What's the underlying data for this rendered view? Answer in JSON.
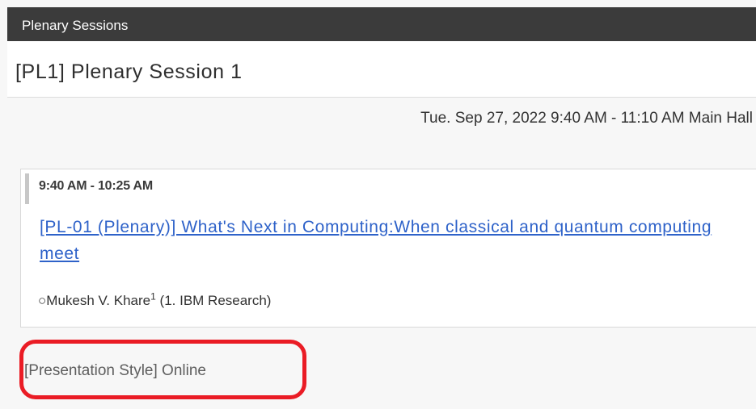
{
  "header": {
    "title": "Plenary Sessions"
  },
  "session": {
    "title": "[PL1] Plenary Session 1",
    "time_location": "Tue. Sep 27, 2022 9:40 AM - 11:10 AM Main Hall"
  },
  "presentation": {
    "time_range": "9:40 AM - 10:25 AM",
    "link_text": "[PL-01 (Plenary)] What's Next in Computing:When classical and quantum computing meet",
    "presenter_prefix": "○",
    "presenter_name": "Mukesh V. Khare",
    "presenter_affiliation_index": "1",
    "presenter_affiliation": " (1. IBM Research)"
  },
  "footer": {
    "presentation_style": "[Presentation Style] Online"
  },
  "colors": {
    "header_bg": "#3b3b3b",
    "link": "#2e62c9",
    "highlight": "#ea1c25"
  }
}
